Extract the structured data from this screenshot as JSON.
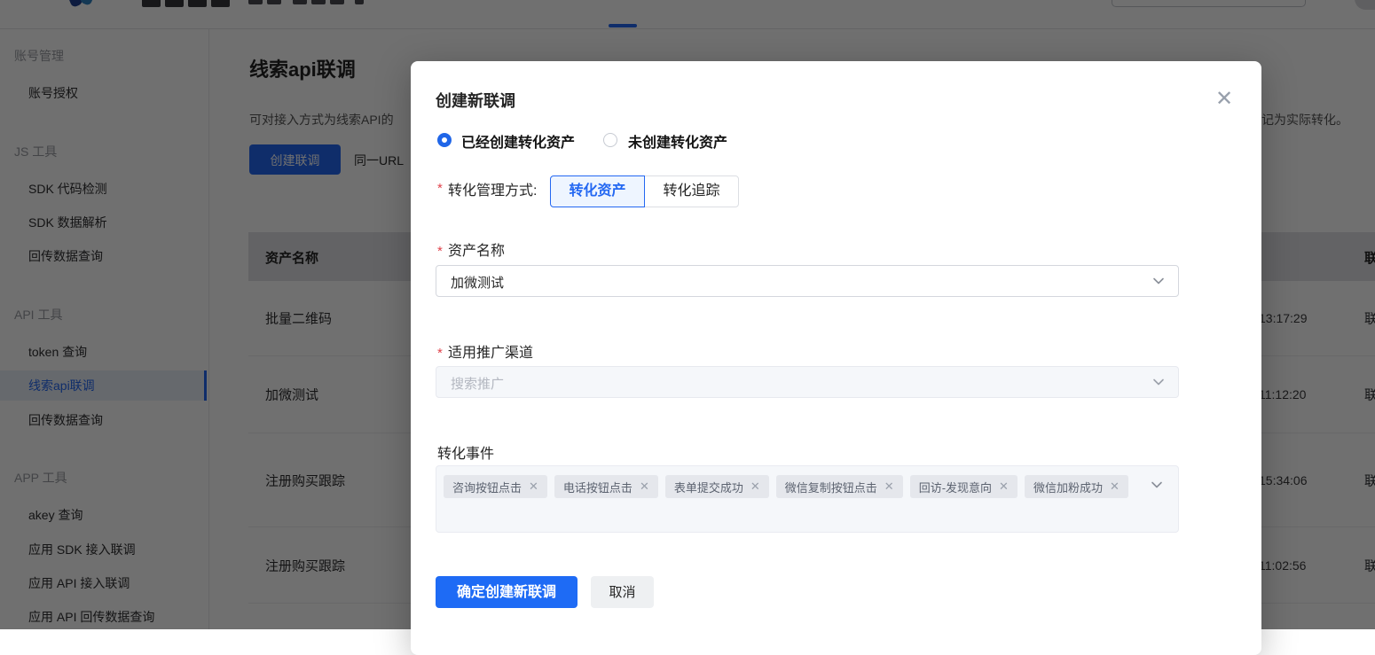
{
  "colors": {
    "primary": "#2468F2",
    "required": "#E0424B"
  },
  "icons": {
    "close": "✕",
    "tag_remove": "✕"
  },
  "sidebar": {
    "groups": [
      {
        "label": "账号管理",
        "items": [
          {
            "label": "账号授权"
          }
        ]
      },
      {
        "label": "JS 工具",
        "items": [
          {
            "label": "SDK 代码检测"
          },
          {
            "label": "SDK 数据解析"
          },
          {
            "label": "回传数据查询"
          }
        ]
      },
      {
        "label": "API 工具",
        "items": [
          {
            "label": "token 查询"
          },
          {
            "label": "线索api联调",
            "active": true
          },
          {
            "label": "回传数据查询"
          }
        ]
      },
      {
        "label": "APP 工具",
        "items": [
          {
            "label": "akey 查询"
          },
          {
            "label": "应用 SDK 接入联调"
          },
          {
            "label": "应用 API 接入联调"
          },
          {
            "label": "应用 API 回传数据查询"
          }
        ]
      }
    ]
  },
  "main": {
    "title": "线索api联调",
    "description_left": "可对接入方式为线索API的",
    "description_right": "记为实际转化。",
    "create_button": "创建联调",
    "url_text": "同一URL",
    "table": {
      "header_name": "资产名称",
      "header_record": "联",
      "rows": [
        {
          "name": "批量二维码",
          "time": "13:17:29",
          "record": "联"
        },
        {
          "name": "加微测试",
          "time": "11:12:20",
          "record": "联"
        },
        {
          "name": "注册购买跟踪",
          "time": "15:34:06",
          "record": "联"
        },
        {
          "name": "注册购买跟踪",
          "time": "11:02:56",
          "record": "联"
        }
      ]
    }
  },
  "modal": {
    "title": "创建新联调",
    "required_mark": "*",
    "radios": [
      {
        "label": "已经创建转化资产",
        "selected": true
      },
      {
        "label": "未创建转化资产",
        "selected": false
      }
    ],
    "fields": {
      "manage_mode": {
        "label": "转化管理方式:",
        "options": [
          {
            "label": "转化资产",
            "selected": true
          },
          {
            "label": "转化追踪",
            "selected": false
          }
        ]
      },
      "asset_name": {
        "label": "资产名称",
        "value": "加微测试"
      },
      "channel": {
        "label": "适用推广渠道",
        "value": "搜索推广",
        "disabled": true
      },
      "events": {
        "label": "转化事件",
        "tags": [
          "咨询按钮点击",
          "电话按钮点击",
          "表单提交成功",
          "微信复制按钮点击",
          "回访-发现意向",
          "微信加粉成功"
        ]
      }
    },
    "confirm_button": "确定创建新联调",
    "cancel_button": "取消"
  }
}
